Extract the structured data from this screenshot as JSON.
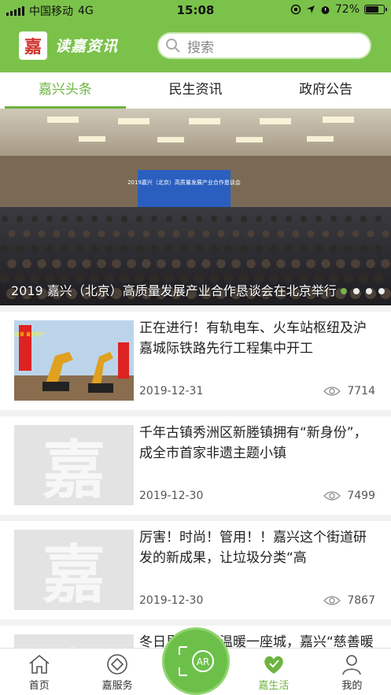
{
  "status_bar": {
    "carrier": "中国移动",
    "network": "4G",
    "time": "15:08",
    "battery": "72%",
    "battery_level": 0.72
  },
  "header": {
    "logo_char": "嘉",
    "app_title": "读嘉资讯",
    "search_placeholder": "搜索"
  },
  "tabs": [
    {
      "label": "嘉兴头条",
      "active": true
    },
    {
      "label": "民生资讯",
      "active": false
    },
    {
      "label": "政府公告",
      "active": false
    }
  ],
  "banner": {
    "caption": "2019 嘉兴（北京）高质量发展产业合作恳谈会在北京举行",
    "slide_count": 4,
    "active_index": 0,
    "screen_text": "2019嘉兴（北京）高质量发展产业合作恳谈会"
  },
  "news": [
    {
      "title": "正在进行！有轨电车、火车站枢纽及沪嘉城际铁路先行工程集中开工",
      "date": "2019-12-31",
      "views": "7714",
      "thumb": "photo"
    },
    {
      "title": "千年古镇秀洲区新塍镇拥有“新身份”，成全市首家非遗主题小镇",
      "date": "2019-12-30",
      "views": "7499",
      "thumb": "placeholder"
    },
    {
      "title": "厉害！时尚！管用！！嘉兴这个街道研发的新成果，让垃圾分类“高",
      "date": "2019-12-30",
      "views": "7867",
      "thumb": "placeholder"
    },
    {
      "title": "冬日里一条街温暖一座城，嘉兴“慈善暖心驿站”启用！",
      "date": "",
      "views": "",
      "thumb": "placeholder"
    }
  ],
  "placeholder_char": "嘉",
  "photo_banner_text": "深化改革 奋力前行",
  "tabbar": {
    "items": [
      {
        "label": "首页",
        "icon": "home-icon",
        "active": false
      },
      {
        "label": "嘉服务",
        "icon": "service-icon",
        "active": false
      },
      {
        "label": "嘉生活",
        "icon": "heart-icon",
        "active": true
      },
      {
        "label": "我的",
        "icon": "user-icon",
        "active": false
      }
    ],
    "center_button_icon": "ar-scan-icon"
  },
  "colors": {
    "accent": "#7bc24a",
    "active_text": "#6cb43f"
  }
}
